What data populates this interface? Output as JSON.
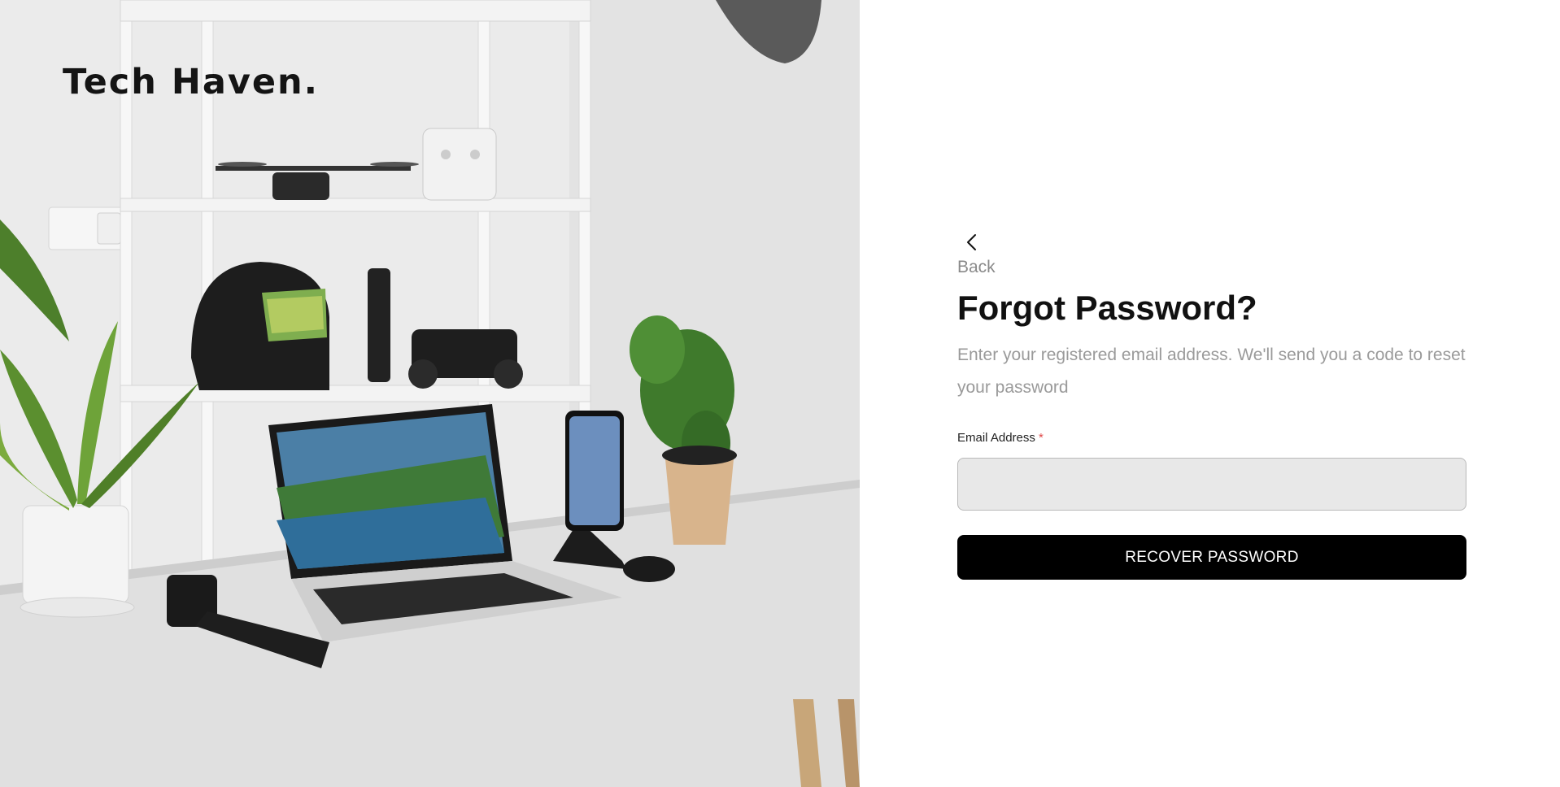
{
  "brand": {
    "name": "Tech Haven."
  },
  "form": {
    "back_label": "Back",
    "title": "Forgot Password?",
    "subtitle": "Enter your registered email address. We'll send you a code to reset your password",
    "email_label": "Email Address",
    "email_required_mark": "*",
    "email_value": "",
    "email_placeholder": "",
    "submit_label": "RECOVER PASSWORD"
  },
  "icons": {
    "back": "chevron-left-icon"
  },
  "colors": {
    "button_bg": "#000000",
    "input_bg": "#e8e8e8",
    "required": "#e04848",
    "muted_text": "#9a9a9a"
  }
}
